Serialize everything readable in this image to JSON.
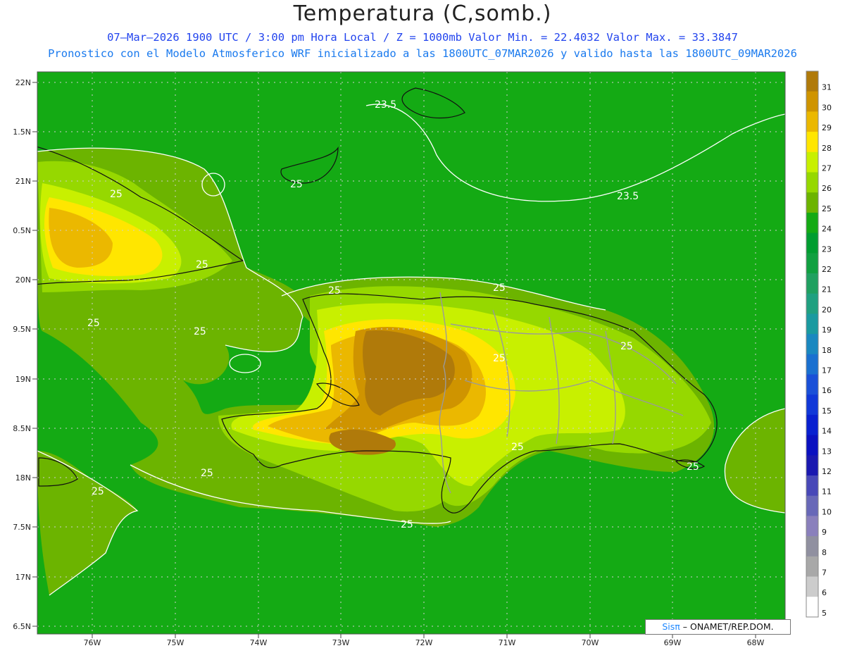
{
  "title": "Temperatura (C,somb.)",
  "subtitle_1": "07—Mar—2026  1900 UTC / 3:00 pm Hora Local / Z = 1000mb   Valor Min. = 22.4032  Valor Max. = 33.3847",
  "subtitle_2": "Pronostico con el Modelo Atmosferico WRF inicializado a las 1800UTC_07MAR2026 y valido hasta las  1800UTC_09MAR2026",
  "credit": {
    "brand": "Sisπ",
    "text": " – ONAMET/REP.DOM."
  },
  "lat_labels": [
    "22N",
    "1.5N",
    "21N",
    "0.5N",
    "20N",
    "9.5N",
    "19N",
    "8.5N",
    "18N",
    "7.5N",
    "17N",
    "6.5N"
  ],
  "lon_labels": [
    "76W",
    "75W",
    "74W",
    "73W",
    "72W",
    "71W",
    "70W",
    "69W",
    "68W"
  ],
  "contour_labels": [
    "23.5",
    "23.5",
    "25",
    "25",
    "25",
    "25",
    "25",
    "25",
    "25",
    "25",
    "25",
    "25",
    "25",
    "25",
    "25",
    "25"
  ],
  "colorbar": {
    "labels": [
      "31",
      "30",
      "29",
      "28",
      "27",
      "26",
      "25",
      "24",
      "23",
      "22",
      "21",
      "20",
      "19",
      "18",
      "17",
      "16",
      "15",
      "14",
      "13",
      "12",
      "11",
      "10",
      "9",
      "8",
      "7",
      "6",
      "5"
    ],
    "colors": [
      "#b07a0a",
      "#cf9400",
      "#ebb800",
      "#ffe600",
      "#c8f000",
      "#96d800",
      "#6cb400",
      "#14aa14",
      "#009d30",
      "#10a040",
      "#20a060",
      "#20a080",
      "#1a9aa0",
      "#1a88c0",
      "#1a70d0",
      "#1a50d8",
      "#1038d8",
      "#0820d0",
      "#0a10c0",
      "#1a18b0",
      "#4848b8",
      "#6868b8",
      "#8a80bc",
      "#9090a0",
      "#a8a8a8",
      "#cccccc",
      "#ffffff"
    ]
  }
}
